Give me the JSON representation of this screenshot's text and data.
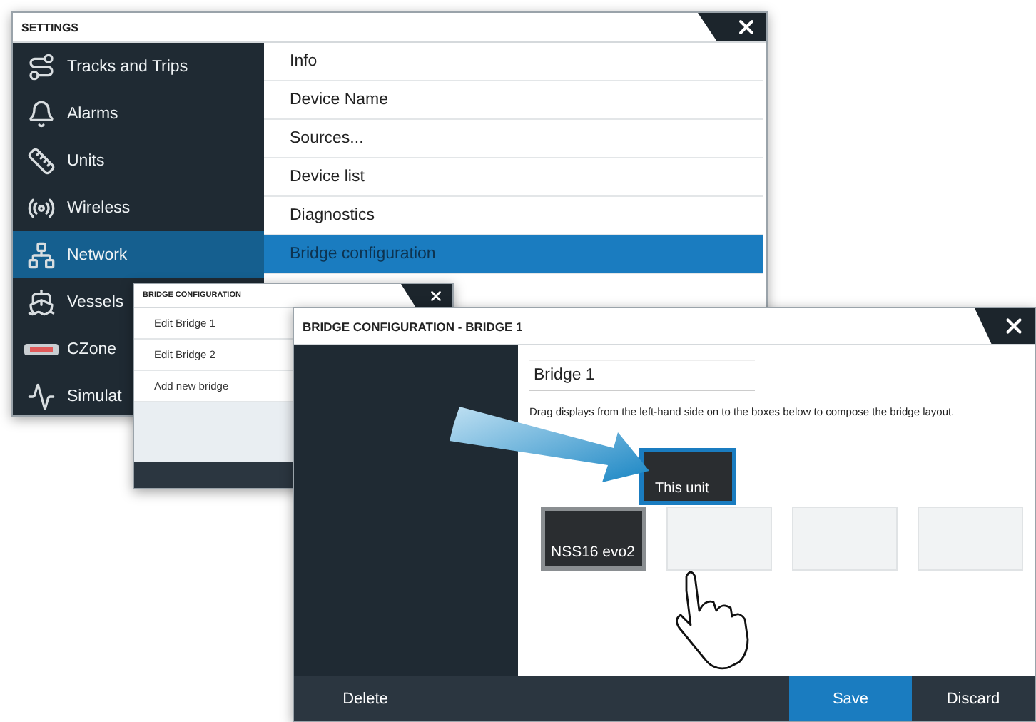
{
  "settings": {
    "title": "SETTINGS",
    "sidebar": [
      {
        "label": "Tracks and Trips",
        "selected": false
      },
      {
        "label": "Alarms",
        "selected": false
      },
      {
        "label": "Units",
        "selected": false
      },
      {
        "label": "Wireless",
        "selected": false
      },
      {
        "label": "Network",
        "selected": true
      },
      {
        "label": "Vessels",
        "selected": false
      },
      {
        "label": "CZone",
        "selected": false
      },
      {
        "label": "Simulat",
        "selected": false
      }
    ],
    "menu": [
      {
        "label": "Info",
        "selected": false
      },
      {
        "label": "Device Name",
        "selected": false
      },
      {
        "label": "Sources...",
        "selected": false
      },
      {
        "label": "Device list",
        "selected": false
      },
      {
        "label": "Diagnostics",
        "selected": false
      },
      {
        "label": "Bridge configuration",
        "selected": true
      }
    ]
  },
  "bridge_list": {
    "title": "BRIDGE CONFIGURATION",
    "items": [
      {
        "label": "Edit Bridge 1"
      },
      {
        "label": "Edit Bridge 2"
      },
      {
        "label": "Add new bridge"
      }
    ]
  },
  "bridge_dialog": {
    "title": "BRIDGE CONFIGURATION - BRIDGE 1",
    "name": "Bridge 1",
    "instructions": "Drag displays from the left-hand side on to the boxes below to compose the bridge layout.",
    "slots": [
      {
        "kind": "display",
        "label": "NSS16 evo2"
      },
      {
        "kind": "empty"
      },
      {
        "kind": "empty"
      },
      {
        "kind": "empty"
      }
    ],
    "dragged_tile": {
      "label": "This unit"
    },
    "buttons": [
      {
        "label": "Delete",
        "kind": "plain"
      },
      {
        "label": "Save",
        "kind": "primary"
      },
      {
        "label": "Discard",
        "kind": "plain"
      }
    ]
  }
}
